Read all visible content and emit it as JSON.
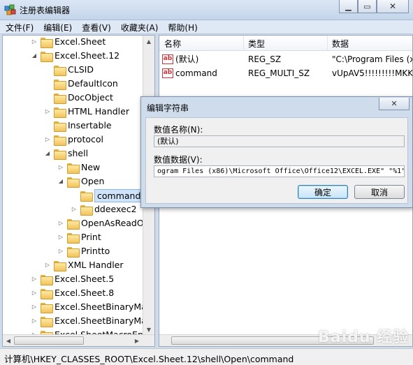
{
  "window": {
    "title": "注册表编辑器"
  },
  "menu": [
    "文件(F)",
    "编辑(E)",
    "查看(V)",
    "收藏夹(A)",
    "帮助(H)"
  ],
  "tree": [
    {
      "label": "Excel.Sheet",
      "arrow": "▷",
      "depth": 2
    },
    {
      "label": "Excel.Sheet.12",
      "arrow": "◢",
      "depth": 2
    },
    {
      "label": "CLSID",
      "arrow": "",
      "depth": 3
    },
    {
      "label": "DefaultIcon",
      "arrow": "",
      "depth": 3
    },
    {
      "label": "DocObject",
      "arrow": "",
      "depth": 3
    },
    {
      "label": "HTML Handler",
      "arrow": "▷",
      "depth": 3
    },
    {
      "label": "Insertable",
      "arrow": "",
      "depth": 3
    },
    {
      "label": "protocol",
      "arrow": "▷",
      "depth": 3
    },
    {
      "label": "shell",
      "arrow": "◢",
      "depth": 3
    },
    {
      "label": "New",
      "arrow": "▷",
      "depth": 4
    },
    {
      "label": "Open",
      "arrow": "◢",
      "depth": 4
    },
    {
      "label": "command",
      "arrow": "",
      "depth": 5,
      "selected": true
    },
    {
      "label": "ddeexec2",
      "arrow": "▷",
      "depth": 5
    },
    {
      "label": "OpenAsReadO",
      "arrow": "▷",
      "depth": 4
    },
    {
      "label": "Print",
      "arrow": "▷",
      "depth": 4
    },
    {
      "label": "Printto",
      "arrow": "▷",
      "depth": 4
    },
    {
      "label": "XML Handler",
      "arrow": "▷",
      "depth": 3
    },
    {
      "label": "Excel.Sheet.5",
      "arrow": "▷",
      "depth": 2
    },
    {
      "label": "Excel.Sheet.8",
      "arrow": "▷",
      "depth": 2
    },
    {
      "label": "Excel.SheetBinaryMac",
      "arrow": "▷",
      "depth": 2
    },
    {
      "label": "Excel.SheetBinaryMac",
      "arrow": "▷",
      "depth": 2
    },
    {
      "label": "Excel.SheetMacroEna",
      "arrow": "▷",
      "depth": 2
    }
  ],
  "list": {
    "columns": [
      "名称",
      "类型",
      "数据"
    ],
    "rows": [
      {
        "name": "(默认)",
        "type": "REG_SZ",
        "data": "\"C:\\Program Files (x"
      },
      {
        "name": "command",
        "type": "REG_MULTI_SZ",
        "data": "vUpAV5!!!!!!!!!MKKS"
      }
    ]
  },
  "dialog": {
    "title": "编辑字符串",
    "name_label": "数值名称(N):",
    "name_value": "(默认)",
    "data_label": "数值数据(V):",
    "data_value": "ogram Files (x86)\\Microsoft Office\\Office12\\EXCEL.EXE\" \"%1\"",
    "ok_label": "确定",
    "cancel_label": "取消"
  },
  "status": {
    "path": "计算机\\HKEY_CLASSES_ROOT\\Excel.Sheet.12\\shell\\Open\\command"
  },
  "watermark": "Baidu 经验"
}
